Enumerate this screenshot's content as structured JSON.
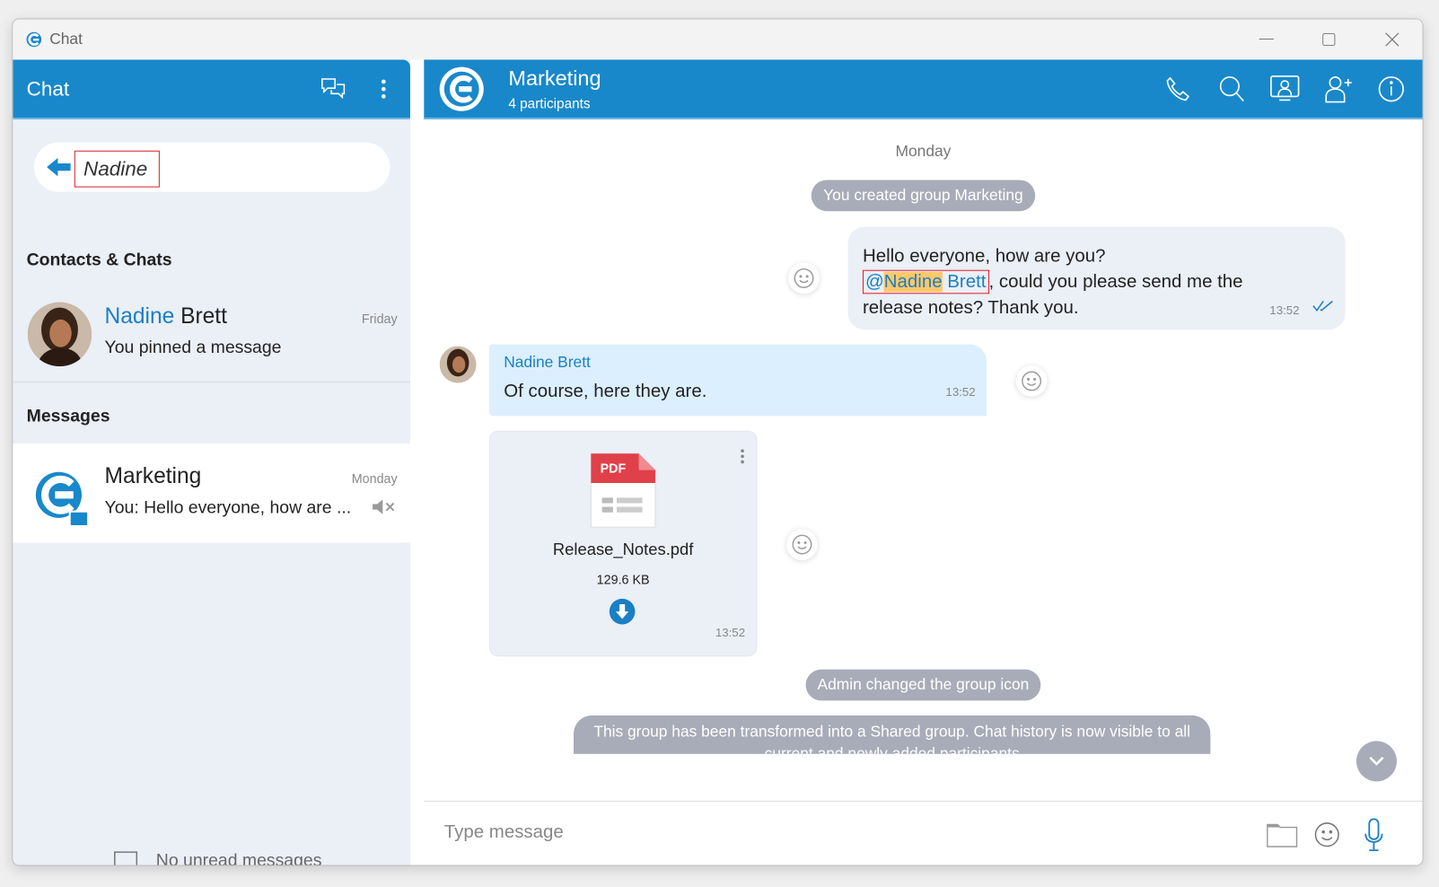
{
  "window": {
    "title": "Chat",
    "controls": [
      "minimize",
      "maximize",
      "close"
    ]
  },
  "sidebar": {
    "title": "Chat",
    "search": {
      "value": "Nadine"
    },
    "contacts_heading": "Contacts & Chats",
    "contacts": [
      {
        "name_match": "Nadine",
        "name_rest": " Brett",
        "subtitle": "You pinned a message",
        "date": "Friday"
      }
    ],
    "messages_heading": "Messages",
    "messages": [
      {
        "name": "Marketing",
        "preview": "You: Hello everyone, how are ...",
        "date": "Monday",
        "muted": true
      }
    ],
    "footer": "No unread messages"
  },
  "chat": {
    "title": "Marketing",
    "participants": "4 participants",
    "day": "Monday",
    "system1": "You created group Marketing",
    "msg1": {
      "line1": "Hello everyone, how are you?",
      "mention_at": "@",
      "mention_first": "Nadine",
      "mention_last": " Brett",
      "rest": ", could you please send me the",
      "line3": "release notes? Thank you.",
      "time": "13:52",
      "status": "read"
    },
    "msg2": {
      "sender": "Nadine Brett",
      "text": "Of course, here they are.",
      "time": "13:52"
    },
    "file": {
      "badge": "PDF",
      "name": "Release_Notes.pdf",
      "size": "129.6 KB",
      "time": "13:52"
    },
    "system2": "Admin changed the group icon",
    "system3": "This group has been transformed into a Shared group. Chat history is now visible to all current and newly added participants",
    "input_placeholder": "Type message"
  },
  "colors": {
    "brand": "#1888ca",
    "mention_highlight": "#ffc86a",
    "system_pill": "#a8acb8",
    "incoming_bubble": "#dcefff",
    "outgoing_bubble": "#ebeff6"
  }
}
